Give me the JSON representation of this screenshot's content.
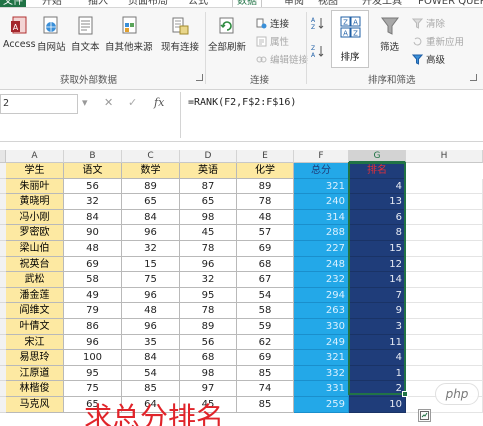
{
  "ribbon": {
    "tabs": [
      {
        "label": "文件",
        "kind": "file"
      },
      {
        "label": "开始"
      },
      {
        "label": "插入"
      },
      {
        "label": "页面布局"
      },
      {
        "label": "公式"
      },
      {
        "label": "数据",
        "kind": "active"
      },
      {
        "label": "审阅"
      },
      {
        "label": "视图"
      },
      {
        "label": "开发工具"
      },
      {
        "label": "POWER QUERY"
      }
    ],
    "external": {
      "access": "Access",
      "web": "自网站",
      "text": "自文本",
      "other": "自其他来源",
      "existing": "现有连接",
      "group": "获取外部数据"
    },
    "connections": {
      "refresh": "全部刷新",
      "connect": "连接",
      "properties": "属性",
      "edit_links": "编辑链接",
      "group": "连接"
    },
    "sortfilter": {
      "sort": "排序",
      "filter": "筛选",
      "clear": "清除",
      "reapply": "重新应用",
      "advanced": "高级",
      "group": "排序和筛选"
    }
  },
  "formula_bar": {
    "name_box": "2",
    "fx": "fx",
    "formula": "=RANK(F2,F$2:F$16)"
  },
  "sheet": {
    "columns": [
      "A",
      "B",
      "C",
      "D",
      "E",
      "F",
      "G",
      "H"
    ],
    "headers": [
      "学生",
      "语文",
      "数学",
      "英语",
      "化学",
      "总分",
      "排名"
    ],
    "rows": [
      [
        "朱丽叶",
        "56",
        "89",
        "87",
        "89",
        "321",
        "4"
      ],
      [
        "黄晓明",
        "32",
        "65",
        "65",
        "78",
        "240",
        "13"
      ],
      [
        "冯小刚",
        "84",
        "84",
        "98",
        "48",
        "314",
        "6"
      ],
      [
        "罗密欧",
        "90",
        "96",
        "45",
        "57",
        "288",
        "8"
      ],
      [
        "梁山伯",
        "48",
        "32",
        "78",
        "69",
        "227",
        "15"
      ],
      [
        "祝英台",
        "69",
        "15",
        "96",
        "68",
        "248",
        "12"
      ],
      [
        "武松",
        "58",
        "75",
        "32",
        "67",
        "232",
        "14"
      ],
      [
        "潘金莲",
        "49",
        "96",
        "95",
        "54",
        "294",
        "7"
      ],
      [
        "阎维文",
        "79",
        "48",
        "78",
        "58",
        "263",
        "9"
      ],
      [
        "叶倩文",
        "86",
        "96",
        "89",
        "59",
        "330",
        "3"
      ],
      [
        "宋江",
        "96",
        "35",
        "56",
        "62",
        "249",
        "11"
      ],
      [
        "易思玲",
        "100",
        "84",
        "68",
        "69",
        "321",
        "4"
      ],
      [
        "江原道",
        "95",
        "54",
        "98",
        "85",
        "332",
        "1"
      ],
      [
        "林楷俊",
        "75",
        "85",
        "97",
        "74",
        "331",
        "2"
      ],
      [
        "马克风",
        "65",
        "64",
        "45",
        "85",
        "259",
        "10"
      ]
    ]
  },
  "caption": "求总分排名",
  "watermark": "php",
  "colors": {
    "excel_green": "#217346",
    "name_fill": "#fde9a2",
    "total_fill": "#23a8e8",
    "rank_fill": "#1f3d7a",
    "caption_red": "#e0242a"
  }
}
